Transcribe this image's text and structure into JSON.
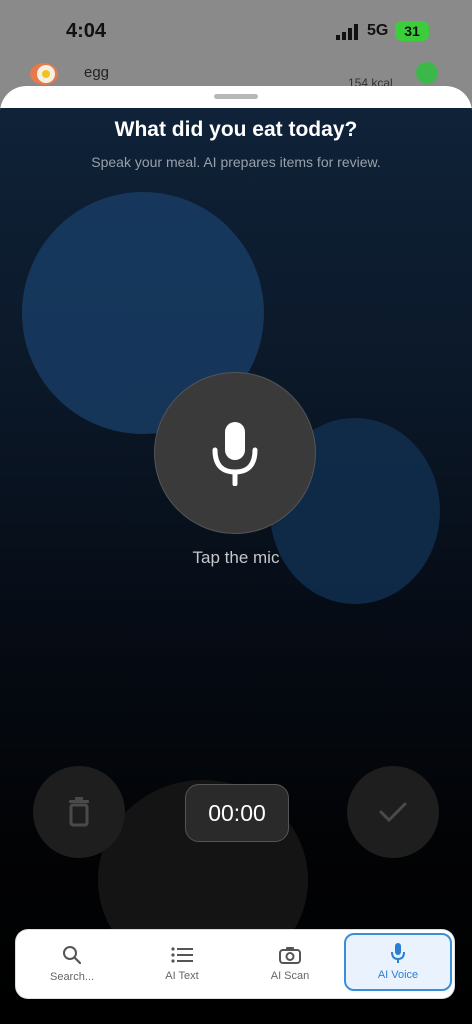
{
  "status_bar": {
    "time": "4:04",
    "network": "5G",
    "battery": "31"
  },
  "background_item": {
    "name": "egg",
    "calories": "154 kcal"
  },
  "sheet": {
    "title": "What did you eat today?",
    "subtitle": "Speak your meal. AI prepares items for review.",
    "mic_caption": "Tap the mic",
    "timer": "00:00"
  },
  "tabs": [
    {
      "label": "Search...",
      "icon": "search-icon"
    },
    {
      "label": "AI Text",
      "icon": "list-icon"
    },
    {
      "label": "AI Scan",
      "icon": "camera-icon"
    },
    {
      "label": "AI Voice",
      "icon": "mic-icon",
      "active": true
    }
  ],
  "colors": {
    "accent": "#3a8fdb",
    "battery": "#3ccd3c",
    "check": "#3cb84a"
  }
}
